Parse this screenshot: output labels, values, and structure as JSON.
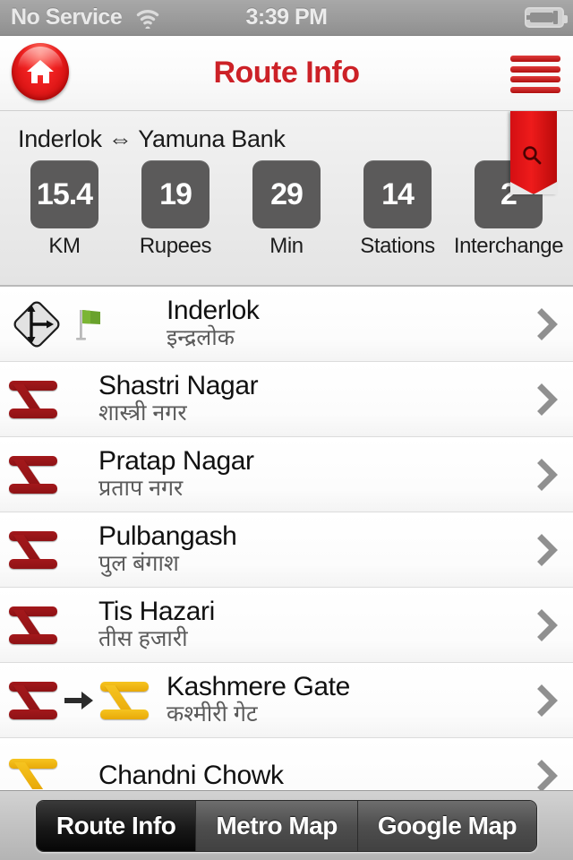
{
  "status_bar": {
    "carrier": "No Service",
    "wifi_icon": "wifi-icon",
    "time": "3:39 PM",
    "battery_icon": "battery-charging-icon"
  },
  "nav_bar": {
    "home_icon": "home-icon",
    "title": "Route Info",
    "menu_icon": "hamburger-menu-icon"
  },
  "summary": {
    "route_title": "Inderlok ⇔ Yamuna Bank",
    "search_ribbon_icon": "search-icon",
    "stats": [
      {
        "value": "15.4",
        "label": "KM"
      },
      {
        "value": "19",
        "label": "Rupees"
      },
      {
        "value": "29",
        "label": "Min"
      },
      {
        "value": "14",
        "label": "Stations"
      },
      {
        "value": "2",
        "label": "Interchange"
      }
    ]
  },
  "stations": [
    {
      "name_en": "Inderlok",
      "name_hi": "इन्द्रलोक",
      "icon_type": "start",
      "line_color": "#8e1215",
      "chevron_icon": "chevron-right-icon"
    },
    {
      "name_en": "Shastri Nagar",
      "name_hi": "शास्त्री नगर",
      "icon_type": "line",
      "line_color": "#8e1215",
      "chevron_icon": "chevron-right-icon"
    },
    {
      "name_en": "Pratap Nagar",
      "name_hi": "प्रताप नगर",
      "icon_type": "line",
      "line_color": "#8e1215",
      "chevron_icon": "chevron-right-icon"
    },
    {
      "name_en": "Pulbangash",
      "name_hi": "पुल बंगाश",
      "icon_type": "line",
      "line_color": "#8e1215",
      "chevron_icon": "chevron-right-icon"
    },
    {
      "name_en": "Tis Hazari",
      "name_hi": "तीस हजारी",
      "icon_type": "line",
      "line_color": "#8e1215",
      "chevron_icon": "chevron-right-icon"
    },
    {
      "name_en": "Kashmere Gate",
      "name_hi": "कश्मीरी गेट",
      "icon_type": "interchange",
      "line_color": "#8e1215",
      "line_color_to": "#e8a908",
      "chevron_icon": "chevron-right-icon"
    },
    {
      "name_en": "Chandni Chowk",
      "name_hi": "",
      "icon_type": "line",
      "line_color": "#e8a908",
      "chevron_icon": "chevron-right-icon"
    }
  ],
  "tab_bar": {
    "items": [
      {
        "label": "Route Info",
        "active": true
      },
      {
        "label": "Metro Map",
        "active": false
      },
      {
        "label": "Google Map",
        "active": false
      }
    ]
  },
  "colors": {
    "brand_red": "#cc2127",
    "red_line": "#8e1215",
    "yellow_line": "#e8a908",
    "stat_box": "#5b5a5a"
  }
}
